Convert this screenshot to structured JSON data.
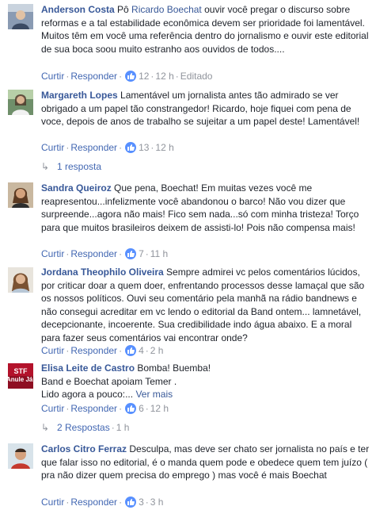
{
  "actions": {
    "like": "Curtir",
    "reply": "Responder",
    "edited": "Editado",
    "see_more": "Ver mais"
  },
  "comments": [
    {
      "name": "Anderson Costa",
      "text_pre": " Pô ",
      "mention": "Ricardo Boechat",
      "text": " ouvir você pregar o discurso sobre reformas e a tal estabilidade econômica devem ser prioridade foi lamentável. Muitos têm em você uma referência dentro do jornalismo e ouvir este editorial de sua boca soou muito estranho aos ouvidos de todos....",
      "likes": "12",
      "time": "12 h"
    },
    {
      "name": "Margareth Lopes",
      "text": " Lamentável um jornalista antes tão admirado se ver obrigado a um papel tão constrangedor! Ricardo, hoje fiquei com pena de voce, depois de anos de trabalho se sujeitar a um papel deste! Lamentável!",
      "likes": "13",
      "time": "12 h",
      "replies": "1 resposta"
    },
    {
      "name": "Sandra Queiroz",
      "text": " Que pena, Boechat! Em muitas vezes você me reapresentou...infelizmente você abandonou o barco! Não vou dizer que surpreende...agora não mais! Fico sem nada...só com minha tristeza! Torço para que muitos brasileiros deixem de assisti-lo! Pois não compensa mais!",
      "likes": "7",
      "time": "11 h"
    },
    {
      "name": "Jordana Theophilo Oliveira",
      "text": " Sempre admirei vc pelos comentários lúcidos, por criticar doar a quem doer, enfrentando processos desse lamaçal que são os nossos políticos. Ouvi seu comentário pela manhã na rádio bandnews e não consegui acreditar em vc lendo o editorial da Band ontem... lamnetável, decepcionante, incoerente. Sua credibilidade indo água abaixo. E a moral para fazer seus comentários vai encontrar onde?",
      "likes": "4",
      "time": "2 h"
    },
    {
      "name": "Elisa Leite de Castro",
      "text": " Bomba! Buemba!",
      "line2": "Band e Boechat apoiam Temer .",
      "line3": "Lido agora a pouco:...",
      "likes": "6",
      "time": "12 h",
      "replies": "2 Respostas",
      "replies_time": "1 h",
      "avatar_text_1": "STF",
      "avatar_text_2": "Anule Já"
    },
    {
      "name": "Carlos Citro Ferraz",
      "text": " Desculpa, mas deve ser chato ser jornalista no país e ter que falar isso no editorial, é o manda quem pode e obedece quem tem juízo ( pra não dizer quem precisa do emprego ) mas você é mais Boechat",
      "likes": "3",
      "time": "3 h"
    }
  ]
}
